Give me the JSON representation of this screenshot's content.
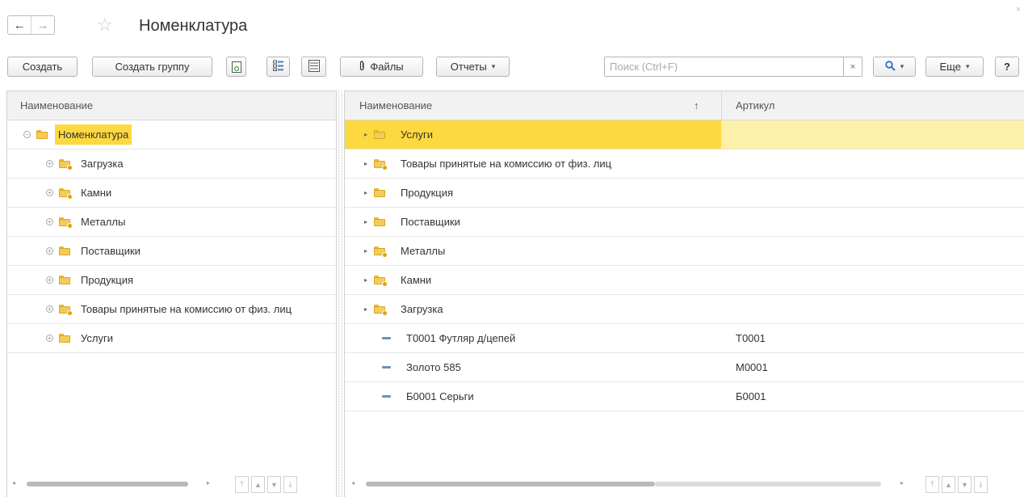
{
  "title_bar": {
    "title": "Номенклатура",
    "back_icon": "←",
    "forward_icon": "→",
    "star_icon": "☆",
    "close_icon": "×"
  },
  "toolbar": {
    "create_label": "Создать",
    "create_group_label": "Создать группу",
    "files_label": "Файлы",
    "files_icon": "paperclip-icon",
    "reports_label": "Отчеты",
    "search_placeholder": "Поиск (Ctrl+F)",
    "search_value": "",
    "clear_icon": "×",
    "more_label": "Еще",
    "help_label": "?"
  },
  "tree_panel": {
    "header": "Наименование",
    "root": {
      "label": "Номенклатура",
      "icon": "folder-icon",
      "expanded": true
    },
    "items": [
      {
        "label": "Загрузка",
        "icon": "folder-special-icon"
      },
      {
        "label": "Камни",
        "icon": "folder-special-icon"
      },
      {
        "label": "Металлы",
        "icon": "folder-special-icon"
      },
      {
        "label": "Поставщики",
        "icon": "folder-icon"
      },
      {
        "label": "Продукция",
        "icon": "folder-icon"
      },
      {
        "label": "Товары принятые на комиссию от физ. лиц",
        "icon": "folder-special-icon"
      },
      {
        "label": "Услуги",
        "icon": "folder-icon"
      }
    ]
  },
  "list_panel": {
    "columns": {
      "name": "Наименование",
      "sort_indicator": "↑",
      "article": "Артикул"
    },
    "rows": [
      {
        "name": "Услуги",
        "article": "",
        "kind": "folder",
        "selected": true
      },
      {
        "name": "Товары принятые на комиссию от физ. лиц",
        "article": "",
        "kind": "folder-special"
      },
      {
        "name": "Продукция",
        "article": "",
        "kind": "folder"
      },
      {
        "name": "Поставщики",
        "article": "",
        "kind": "folder"
      },
      {
        "name": "Металлы",
        "article": "",
        "kind": "folder-special"
      },
      {
        "name": "Камни",
        "article": "",
        "kind": "folder-special"
      },
      {
        "name": "Загрузка",
        "article": "",
        "kind": "folder-special"
      },
      {
        "name": "Т0001 Футляр д/цепей",
        "article": "Т0001",
        "kind": "item"
      },
      {
        "name": "Золото 585",
        "article": "М0001",
        "kind": "item"
      },
      {
        "name": "Б0001 Серьги",
        "article": "Б0001",
        "kind": "item"
      }
    ]
  },
  "colors": {
    "selected_strong": "#fcd93f",
    "selected_light": "#fdf0a8",
    "folder": "#f2cc5a"
  }
}
